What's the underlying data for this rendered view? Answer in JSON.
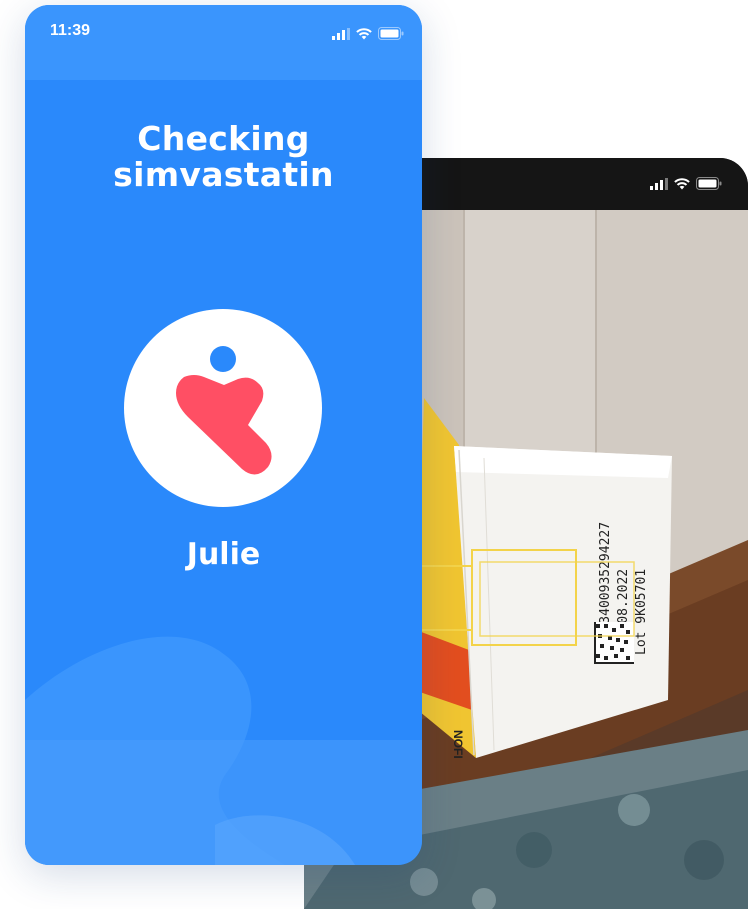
{
  "front_phone": {
    "status_bar": {
      "time": "11:39",
      "icons": [
        "cellular-signal-icon",
        "wifi-icon",
        "battery-icon"
      ]
    },
    "title_line_1": "Checking",
    "title_line_2": "simvastatin",
    "avatar": {
      "icon": "heart-logo-icon",
      "colors": {
        "heart": "#ff4f64",
        "dot": "#2a89fb",
        "background": "#ffffff"
      }
    },
    "user_name": "Julie"
  },
  "back_phone": {
    "status_bar": {
      "icons": [
        "cellular-signal-icon",
        "wifi-icon",
        "battery-icon"
      ]
    },
    "camera_view": {
      "box_label_lines": [
        "CIP 3400935294227",
        "EXP 08.2022",
        "Lot 9K05701"
      ],
      "brand_text": "NOFI",
      "scan_frame_color": "#f3d34a"
    }
  },
  "colors": {
    "primary_blue": "#2a89fb",
    "status_blue": "#3a95fd",
    "accent_red": "#ff4f64",
    "dark_frame": "#151515"
  }
}
